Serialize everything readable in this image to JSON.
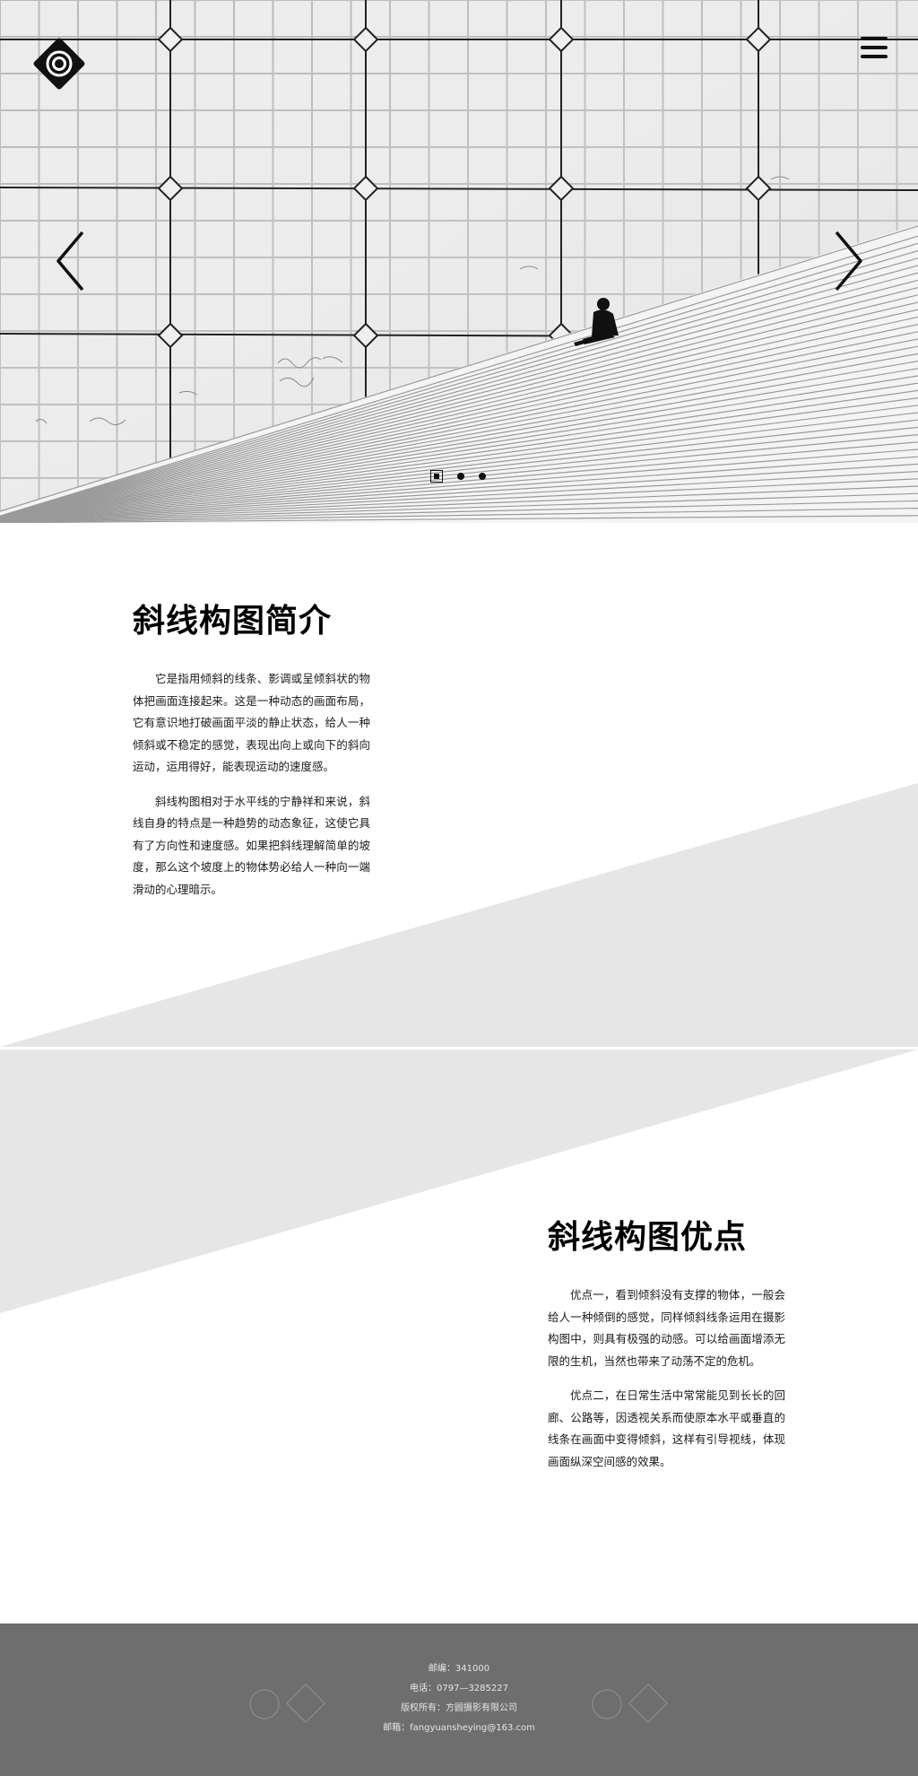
{
  "header": {
    "logo_icon": "camera-lens-diamond-icon",
    "menu_icon": "hamburger-menu-icon"
  },
  "carousel": {
    "prev_icon": "chevron-left-icon",
    "next_icon": "chevron-right-icon",
    "slide_count": 3,
    "active_slide": 1
  },
  "intro": {
    "title": "斜线构图简介",
    "paragraphs": [
      "它是指用倾斜的线条、影调或呈倾斜状的物体把画面连接起来。这是一种动态的画面布局，它有意识地打破画面平淡的静止状态，给人一种倾斜或不稳定的感觉，表现出向上或向下的斜向运动，运用得好，能表现运动的速度感。",
      "斜线构图相对于水平线的宁静祥和来说，斜线自身的特点是一种趋势的动态象征，这使它具有了方向性和速度感。如果把斜线理解简单的坡度，那么这个坡度上的物体势必给人一种向一端滑动的心理暗示。"
    ]
  },
  "advantages": {
    "title": "斜线构图优点",
    "paragraphs": [
      "优点一，看到倾斜没有支撑的物体，一般会给人一种倾倒的感觉，同样倾斜线条运用在摄影构图中，则具有极强的动感。可以给画面增添无限的生机，当然也带来了动荡不定的危机。",
      "优点二，在日常生活中常常能见到长长的回廊、公路等，因透视关系而使原本水平或垂直的线条在画面中变得倾斜，这样有引导视线，体现画面纵深空间感的效果。"
    ]
  },
  "footer": {
    "postcode": "邮编：341000",
    "phone": "电话：0797—3285227",
    "copyright": "版权所有：方圆摄影有限公司",
    "email": "邮箱：fangyuanshеying@163.com"
  },
  "colors": {
    "band_gray": "#e6e6e6",
    "footer_bg": "#6e6e6e",
    "footer_text": "#e6e6e6"
  }
}
